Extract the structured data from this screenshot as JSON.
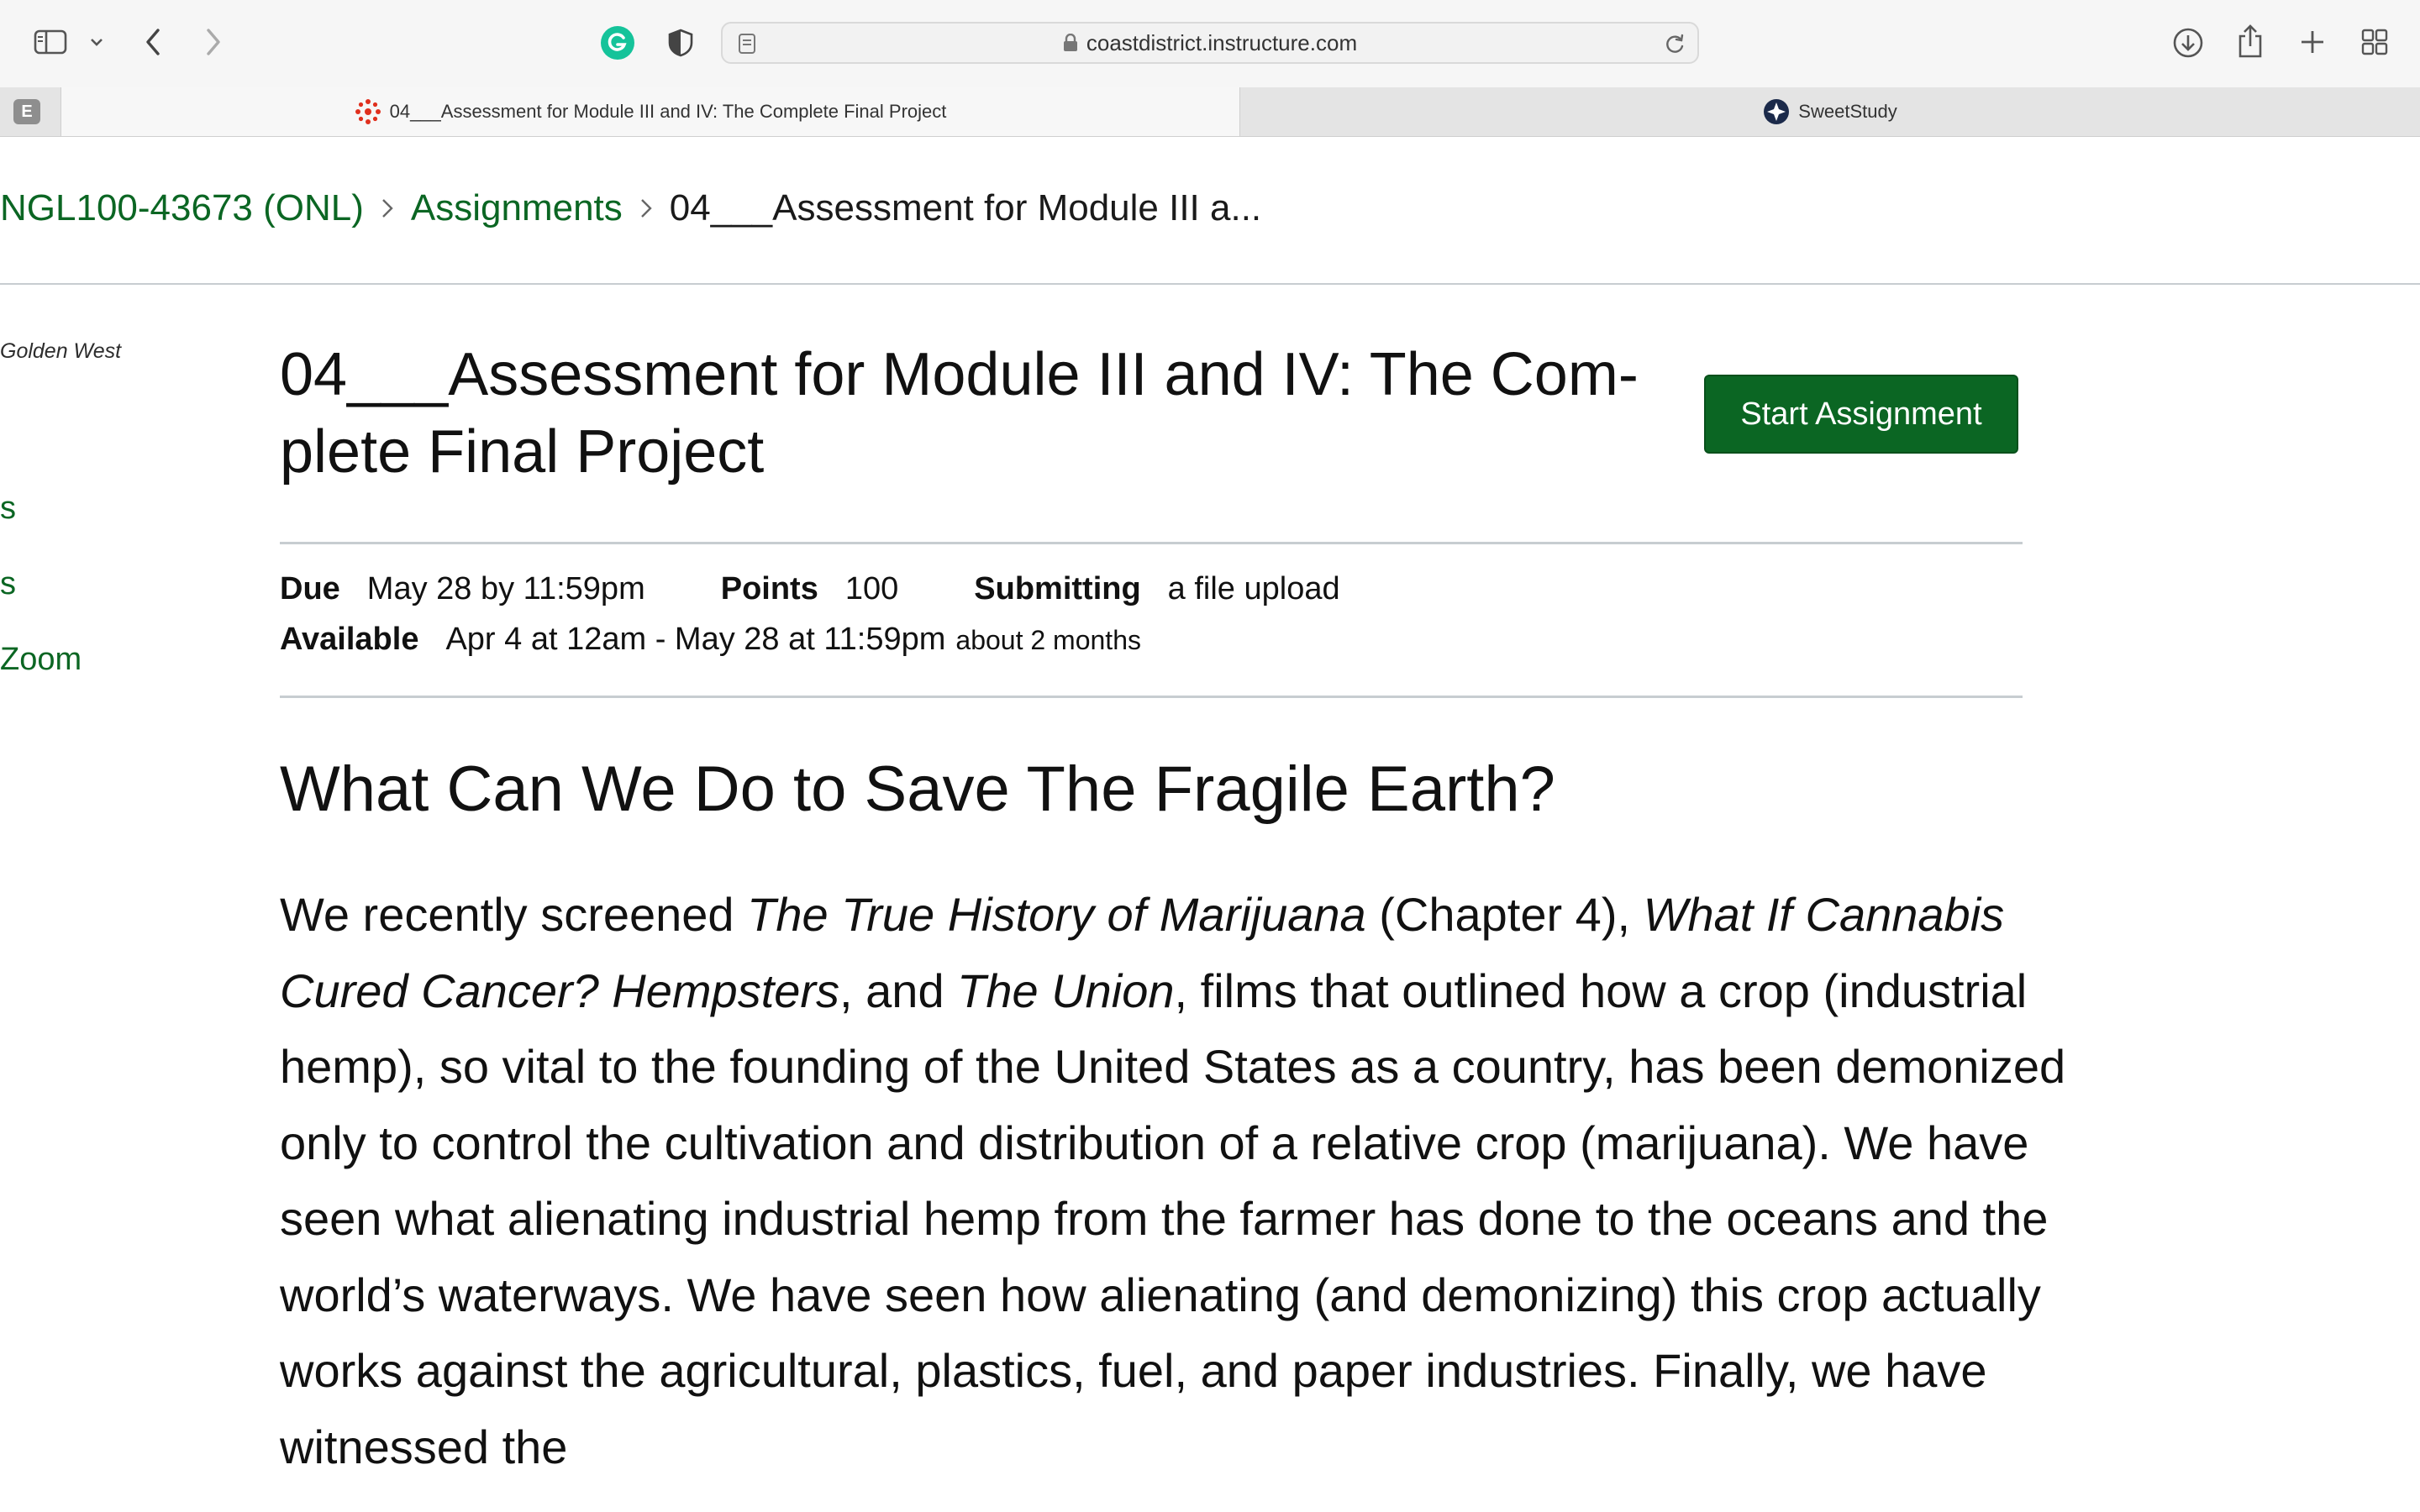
{
  "browser": {
    "url": "coastdistrict.instructure.com",
    "tabs": [
      {
        "label": "04___Assessment for Module III and IV: The Complete Final Project",
        "active": true,
        "icon": "canvas-logo-icon"
      },
      {
        "label": "SweetStudy",
        "active": false,
        "icon": "sweetstudy-logo-icon"
      }
    ],
    "tab_group_letter": "E"
  },
  "breadcrumb": {
    "course": "NGL100-43673 (ONL)",
    "section": "Assignments",
    "current": "04___Assessment for Module III a..."
  },
  "sidebar": {
    "org": "Golden West",
    "items": [
      "s",
      "s",
      "Zoom"
    ]
  },
  "assignment": {
    "title": "04___Assessment for Module III and IV: The Com-plete Final Project",
    "title_line1": "04___Assessment for Module III and IV: The Com-",
    "title_line2": "plete Final Project",
    "start_button": "Start Assignment",
    "due_label": "Due",
    "due_value": "May 28 by 11:59pm",
    "points_label": "Points",
    "points_value": "100",
    "submitting_label": "Submitting",
    "submitting_value": "a file upload",
    "available_label": "Available",
    "available_value": "Apr 4 at 12am - May 28 at 11:59pm",
    "available_duration": "about 2 months"
  },
  "content": {
    "heading": "What Can We Do to Save The Fragile Earth?",
    "p1": {
      "t1": "We recently screened ",
      "i1": "The True History of Marijuana",
      "t2": " (Chapter 4), ",
      "i2": "What If Cannabis Cured Cancer? Hempsters",
      "t3": ", and ",
      "i3": "The Union",
      "t4": ", films that outlined how a crop (industrial hemp), so vital to the founding of the United States as a country, has been demonized only to control the cultivation and distribution of a relative crop (marijuana). We have seen what alienating industrial hemp from the farmer has done to the oceans and the world’s waterways. We have seen how alienating (and demonizing) this crop actually works against the agricultural, plastics, fuel, and paper industries. Finally, we have witnessed the"
    }
  },
  "colors": {
    "accent": "#0b6623",
    "toolbar_bg": "#f6f6f6",
    "grammarly": "#15c39a"
  }
}
